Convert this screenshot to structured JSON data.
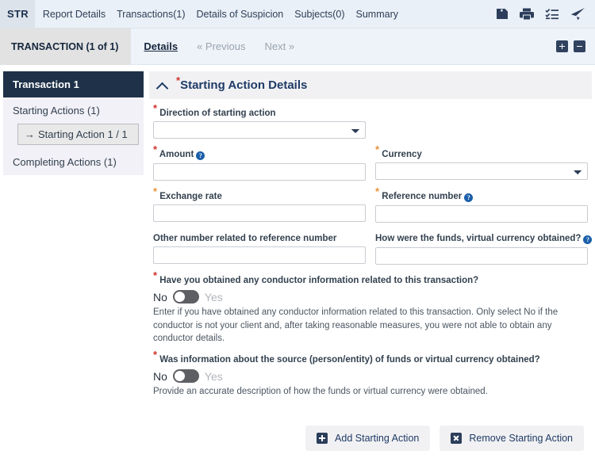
{
  "topbar": {
    "logo": "STR",
    "nav": [
      {
        "label": "Report Details"
      },
      {
        "label": "Transactions(1)"
      },
      {
        "label": "Details of Suspicion"
      },
      {
        "label": "Subjects(0)"
      },
      {
        "label": "Summary"
      }
    ],
    "icons": [
      {
        "name": "save-icon"
      },
      {
        "name": "print-icon"
      },
      {
        "name": "checklist-icon"
      },
      {
        "name": "send-icon"
      }
    ]
  },
  "subbar": {
    "transaction_label": "TRANSACTION (1 of 1)",
    "details_label": "Details",
    "previous_label": "« Previous",
    "next_label": "Next »",
    "expand_all_label": "+",
    "collapse_all_label": "−"
  },
  "sidebar": {
    "header": "Transaction 1",
    "items": [
      {
        "label": "Starting Actions (1)"
      },
      {
        "label": "Starting Action 1 / 1",
        "selected": true
      },
      {
        "label": "Completing Actions (1)"
      }
    ]
  },
  "panel": {
    "title": "Starting Action Details",
    "required_marker": "*",
    "collapse_icon": "chevron-up-icon"
  },
  "fields": {
    "direction": {
      "label": "Direction of starting action",
      "required_color": "#d0342c",
      "value": "",
      "type": "select"
    },
    "amount": {
      "label": "Amount",
      "required_color": "#d0342c",
      "help": "?",
      "value": "",
      "type": "text"
    },
    "currency": {
      "label": "Currency",
      "required_color": "#e8923a",
      "value": "",
      "type": "select"
    },
    "exchange_rate": {
      "label": "Exchange rate",
      "required_color": "#e8923a",
      "value": "",
      "type": "text"
    },
    "reference_number": {
      "label": "Reference number",
      "required_color": "#e8923a",
      "help": "?",
      "value": "",
      "type": "text"
    },
    "other_number": {
      "label": "Other number related to reference number",
      "value": "",
      "type": "text"
    },
    "funds_obtained": {
      "label": "How were the funds, virtual currency obtained?",
      "help": "?",
      "value": "",
      "type": "text"
    }
  },
  "toggles": [
    {
      "question": "Have you obtained any conductor information related to this transaction?",
      "required_marker": "*",
      "off_label": "No",
      "on_label": "Yes",
      "state": "No",
      "help": "Enter if you have obtained any conductor information related to this transaction. Only select No if the conductor is not your client and, after taking reasonable measures, you were not able to obtain any conductor details."
    },
    {
      "question": "Was information about the source (person/entity) of funds or virtual currency obtained?",
      "required_marker": "*",
      "off_label": "No",
      "on_label": "Yes",
      "state": "No",
      "help": "Provide an accurate description of how the funds or virtual currency were obtained."
    }
  ],
  "footer": {
    "add_label": "Add Starting Action",
    "remove_label": "Remove Starting Action"
  },
  "colors": {
    "navy": "#1e3148",
    "accent_blue": "#1f3b66",
    "required_red": "#d0342c",
    "required_orange": "#e8923a"
  }
}
